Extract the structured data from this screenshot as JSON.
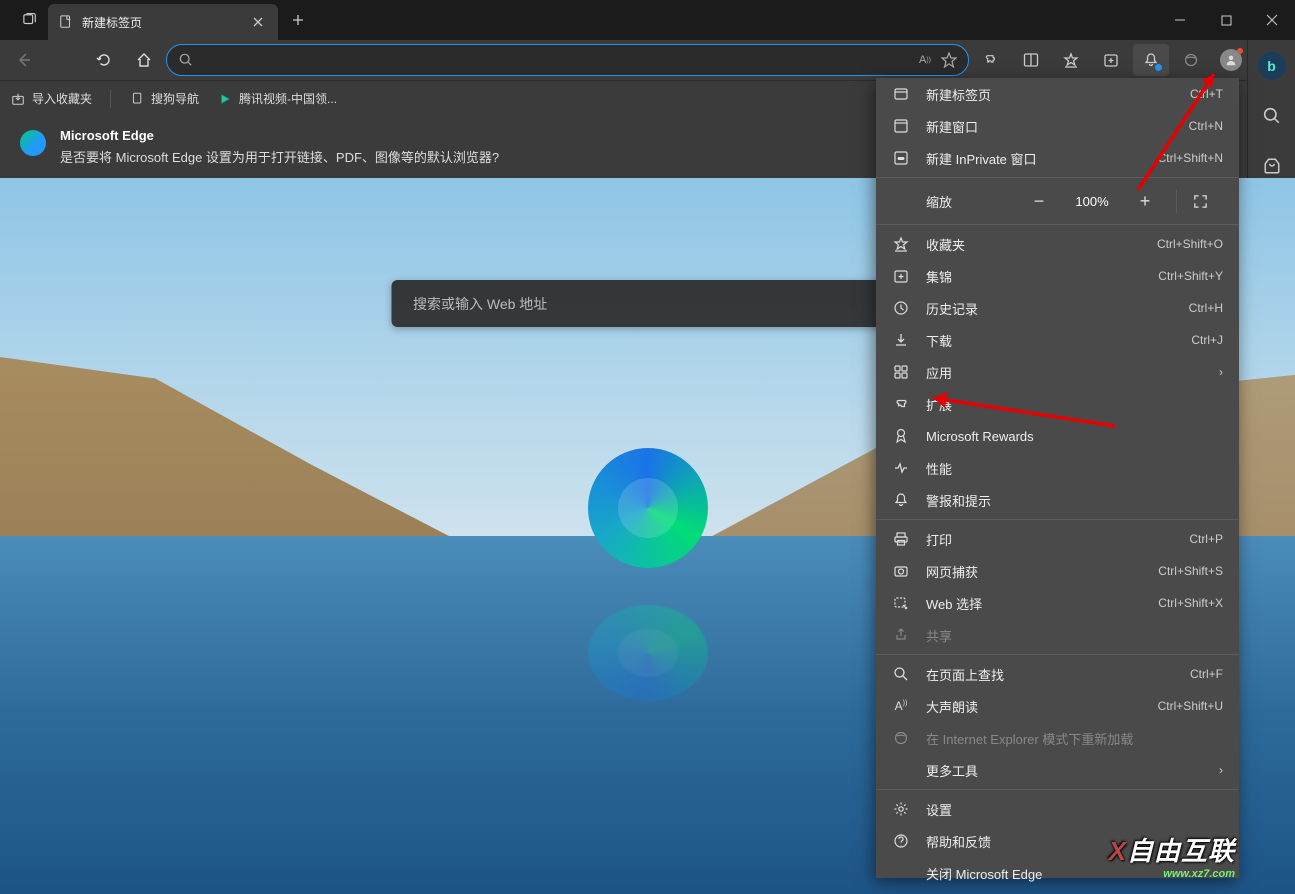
{
  "titlebar": {
    "tab_title": "新建标签页"
  },
  "bookmarks": {
    "import": "导入收藏夹",
    "item1": "搜狗导航",
    "item2": "腾讯视频-中国领..."
  },
  "banner": {
    "title": "Microsoft Edge",
    "text": "是否要将 Microsoft Edge 设置为用于打开链接、PDF、图像等的默认浏览器?"
  },
  "search": {
    "placeholder": "搜索或输入 Web 地址"
  },
  "menu": {
    "new_tab": "新建标签页",
    "new_tab_sc": "Ctrl+T",
    "new_window": "新建窗口",
    "new_window_sc": "Ctrl+N",
    "new_inprivate": "新建 InPrivate 窗口",
    "new_inprivate_sc": "Ctrl+Shift+N",
    "zoom_label": "缩放",
    "zoom_value": "100%",
    "favorites": "收藏夹",
    "favorites_sc": "Ctrl+Shift+O",
    "collections": "集锦",
    "collections_sc": "Ctrl+Shift+Y",
    "history": "历史记录",
    "history_sc": "Ctrl+H",
    "downloads": "下载",
    "downloads_sc": "Ctrl+J",
    "apps": "应用",
    "extensions": "扩展",
    "rewards": "Microsoft Rewards",
    "performance": "性能",
    "alerts": "警报和提示",
    "print": "打印",
    "print_sc": "Ctrl+P",
    "capture": "网页捕获",
    "capture_sc": "Ctrl+Shift+S",
    "webselect": "Web 选择",
    "webselect_sc": "Ctrl+Shift+X",
    "share": "共享",
    "find": "在页面上查找",
    "find_sc": "Ctrl+F",
    "readaloud": "大声朗读",
    "readaloud_sc": "Ctrl+Shift+U",
    "iemode": "在 Internet Explorer 模式下重新加载",
    "moretools": "更多工具",
    "settings": "设置",
    "help": "帮助和反馈",
    "close": "关闭 Microsoft Edge"
  },
  "watermark": {
    "main_x": "X",
    "main_rest": "自由互联",
    "sub": "www.xz7.com"
  }
}
